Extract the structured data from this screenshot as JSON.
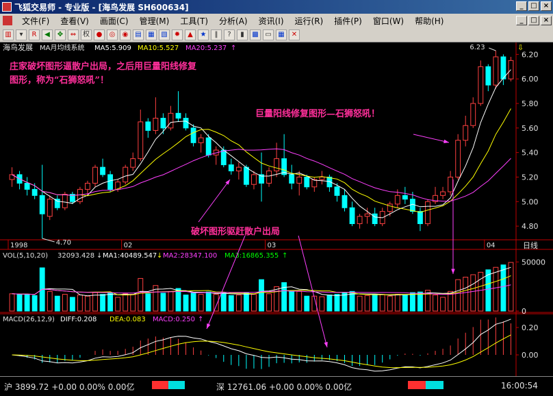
{
  "titlebar": {
    "title": "飞狐交易师 - 专业版 - [海鸟发展 SH600634]",
    "minimize": "_",
    "maximize": "□",
    "close": "×"
  },
  "menu": [
    "文件(F)",
    "查看(V)",
    "画面(C)",
    "管理(M)",
    "工具(T)",
    "分析(A)",
    "资讯(I)",
    "运行(R)",
    "插件(P)",
    "窗口(W)",
    "帮助(H)"
  ],
  "mdi_buttons": [
    "_",
    "□",
    "×"
  ],
  "toolbar_icons": [
    "chart-icon",
    "dropdown-icon",
    "rsi-icon",
    "arrow-left-icon",
    "arrow-right-icon",
    "cross-arrows-icon",
    "double-arrow-icon",
    "weight-icon",
    "circles-icon",
    "circles2-icon",
    "circle3-icon",
    "book-icon",
    "sheet-icon",
    "sheet2-icon",
    "f10-icon",
    "fire-icon",
    "diamond-icon",
    "warning-icon",
    "star-icon",
    "pause-icon",
    "help-icon",
    "bars-icon",
    "grid-icon",
    "doc-icon",
    "table-icon",
    "x-icon"
  ],
  "toolbar_text": {
    "weight": "权"
  },
  "main_panel": {
    "stock": "海鸟发展",
    "indicator": "MA月均线系统",
    "ma5": "MA5:5.909",
    "ma10": "MA10:5.527",
    "ma20": "MA20:5.237",
    "up": "↑"
  },
  "price_axis": [
    "6.20",
    "6.00",
    "5.80",
    "5.60",
    "5.40",
    "5.20",
    "5.00",
    "4.80"
  ],
  "high_label": "6.23",
  "low_label": "4.70",
  "time_labels": [
    "1998",
    "02",
    "03",
    "04"
  ],
  "period_label": "日线",
  "vol_panel": {
    "title": "VOL(5,10,20)",
    "value": "32093.428",
    "ma1": "MA1:40489.547",
    "ma2": "MA2:28347.100",
    "ma3": "MA3:16865.355",
    "down": "↓",
    "up": "↑"
  },
  "vol_axis": [
    "50000",
    "0"
  ],
  "macd_panel": {
    "title": "MACD(26,12,9)",
    "diff": "DIFF:0.208",
    "dea": "DEA:0.083",
    "macd": "MACD:0.250",
    "up": "↑"
  },
  "macd_axis": [
    "0.20",
    "0.00"
  ],
  "annotations": {
    "top_left": [
      "庄家破坏图形逼散户出局，之后用巨量阳线修复",
      "图形，称为“石狮怒吼”！"
    ],
    "right": "巨量阳线修复图形—石狮怒吼！",
    "middle": "破坏图形驱赶散户出局"
  },
  "status": {
    "sh": "沪 3899.72 +0.00 0.00% 0.00亿",
    "sz": "深 12761.06 +0.00 0.00% 0.00亿",
    "time": "16:00:54"
  },
  "colors": {
    "up": "#ff4040",
    "down": "#00ffff",
    "ma5": "#ffffff",
    "ma10": "#ffff00",
    "ma20": "#ff40ff",
    "annot": "#ff2f9a",
    "axis": "#c00000"
  },
  "chart_data": {
    "type": "candlestick",
    "ohlc": [
      [
        5.18,
        5.28,
        5.12,
        5.22
      ],
      [
        5.22,
        5.25,
        5.1,
        5.15
      ],
      [
        5.15,
        5.2,
        5.05,
        5.1
      ],
      [
        5.1,
        5.15,
        5.02,
        5.05
      ],
      [
        5.05,
        5.3,
        4.7,
        4.9
      ],
      [
        4.88,
        5.05,
        4.85,
        5.02
      ],
      [
        5.02,
        5.05,
        4.93,
        4.95
      ],
      [
        4.95,
        5.08,
        4.93,
        5.06
      ],
      [
        5.06,
        5.08,
        4.98,
        5.0
      ],
      [
        5.0,
        5.12,
        4.98,
        5.1
      ],
      [
        5.1,
        5.17,
        5.05,
        5.15
      ],
      [
        5.15,
        5.3,
        5.12,
        5.28
      ],
      [
        5.28,
        5.35,
        5.2,
        5.22
      ],
      [
        5.22,
        5.25,
        5.08,
        5.1
      ],
      [
        5.1,
        5.18,
        5.08,
        5.16
      ],
      [
        5.16,
        5.3,
        5.14,
        5.28
      ],
      [
        5.28,
        5.4,
        5.25,
        5.35
      ],
      [
        5.35,
        5.75,
        5.33,
        5.65
      ],
      [
        5.65,
        5.68,
        5.52,
        5.58
      ],
      [
        5.58,
        5.85,
        5.55,
        5.68
      ],
      [
        5.68,
        5.72,
        5.55,
        5.6
      ],
      [
        5.6,
        5.78,
        5.58,
        5.72
      ],
      [
        5.72,
        5.9,
        5.65,
        5.68
      ],
      [
        5.68,
        5.72,
        5.58,
        5.6
      ],
      [
        5.6,
        5.63,
        5.45,
        5.48
      ],
      [
        5.48,
        5.55,
        5.4,
        5.52
      ],
      [
        5.52,
        5.55,
        5.36,
        5.38
      ],
      [
        5.38,
        5.45,
        5.3,
        5.42
      ],
      [
        5.42,
        5.45,
        5.28,
        5.3
      ],
      [
        5.3,
        5.35,
        5.22,
        5.25
      ],
      [
        5.25,
        5.32,
        5.18,
        5.28
      ],
      [
        5.28,
        5.3,
        5.12,
        5.14
      ],
      [
        5.14,
        5.25,
        5.1,
        5.22
      ],
      [
        5.22,
        5.4,
        5.0,
        5.15
      ],
      [
        5.15,
        5.28,
        5.12,
        5.25
      ],
      [
        5.25,
        5.48,
        5.2,
        5.35
      ],
      [
        5.35,
        5.55,
        5.2,
        5.22
      ],
      [
        5.22,
        5.3,
        5.1,
        5.15
      ],
      [
        5.15,
        5.25,
        5.05,
        5.2
      ],
      [
        5.2,
        5.22,
        5.1,
        5.12
      ],
      [
        5.12,
        5.2,
        5.08,
        5.18
      ],
      [
        5.18,
        5.25,
        5.14,
        5.2
      ],
      [
        5.2,
        5.22,
        5.08,
        5.12
      ],
      [
        5.12,
        5.15,
        5.0,
        5.05
      ],
      [
        5.05,
        5.1,
        4.92,
        4.95
      ],
      [
        4.95,
        5.0,
        4.8,
        4.82
      ],
      [
        4.82,
        4.9,
        4.78,
        4.88
      ],
      [
        4.88,
        4.95,
        4.82,
        4.9
      ],
      [
        4.9,
        4.95,
        4.8,
        4.82
      ],
      [
        4.82,
        4.95,
        4.8,
        4.92
      ],
      [
        4.92,
        5.0,
        4.88,
        4.98
      ],
      [
        4.98,
        5.1,
        4.95,
        5.05
      ],
      [
        5.05,
        5.12,
        4.98,
        5.02
      ],
      [
        5.02,
        5.08,
        4.9,
        4.92
      ],
      [
        4.92,
        4.95,
        4.76,
        4.82
      ],
      [
        4.82,
        5.02,
        4.8,
        5.0
      ],
      [
        5.0,
        5.12,
        4.98,
        5.05
      ],
      [
        5.05,
        5.12,
        5.02,
        5.08
      ],
      [
        5.08,
        5.25,
        5.05,
        5.2
      ],
      [
        5.2,
        5.55,
        5.18,
        5.5
      ],
      [
        5.5,
        5.7,
        5.45,
        5.62
      ],
      [
        5.62,
        5.85,
        5.6,
        5.8
      ],
      [
        5.8,
        6.15,
        5.78,
        6.1
      ],
      [
        6.1,
        6.12,
        5.9,
        5.95
      ],
      [
        5.95,
        6.23,
        5.92,
        6.18
      ],
      [
        6.18,
        6.2,
        5.95,
        6.0
      ],
      [
        6.0,
        6.18,
        5.98,
        6.15
      ]
    ],
    "ylim": [
      4.7,
      6.23
    ],
    "vol_ylim": [
      0,
      60000
    ],
    "macd_ylim": [
      -0.12,
      0.28
    ]
  }
}
